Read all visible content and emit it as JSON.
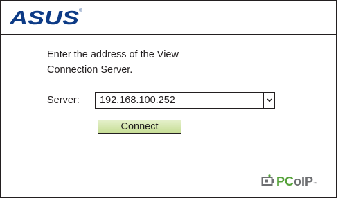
{
  "header": {
    "logo_text": "ASUS",
    "trademark": "®"
  },
  "prompt": {
    "line1": "Enter the address of the View",
    "line2": "Connection Server."
  },
  "server": {
    "label": "Server:",
    "value": "192.168.100.252",
    "dropdown_icon": "chevron-down-icon"
  },
  "connect_button": {
    "label": "Connect"
  },
  "footer": {
    "logo_pc": "PC",
    "logo_oip": "oIP",
    "logo_tm": "™"
  },
  "colors": {
    "brand_blue": "#0d3b86",
    "button_green": "#c7de96",
    "pcoip_green": "#56a23a",
    "text": "#231f20"
  }
}
